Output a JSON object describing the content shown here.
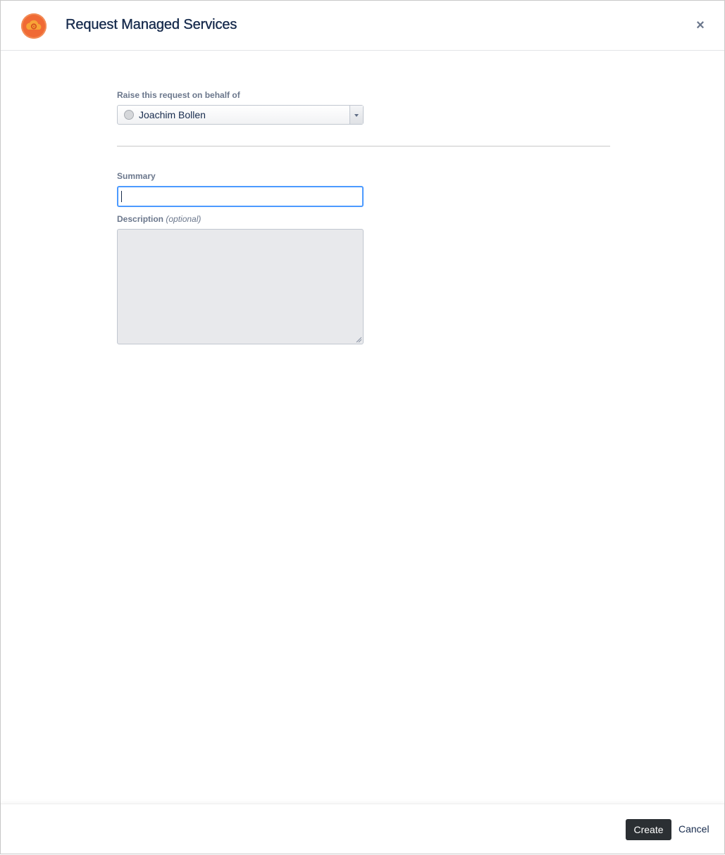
{
  "dialog": {
    "title": "Request Managed Services",
    "close_icon": "close-icon",
    "logo_icon": "cloud-gear-icon",
    "brand_color": "#f06a35"
  },
  "form": {
    "on_behalf_label": "Raise this request on behalf of",
    "on_behalf_value": "Joachim Bollen",
    "summary_label": "Summary",
    "summary_value": "",
    "description_label": "Description",
    "description_optional": "(optional)",
    "description_value": ""
  },
  "footer": {
    "create_label": "Create",
    "cancel_label": "Cancel"
  }
}
